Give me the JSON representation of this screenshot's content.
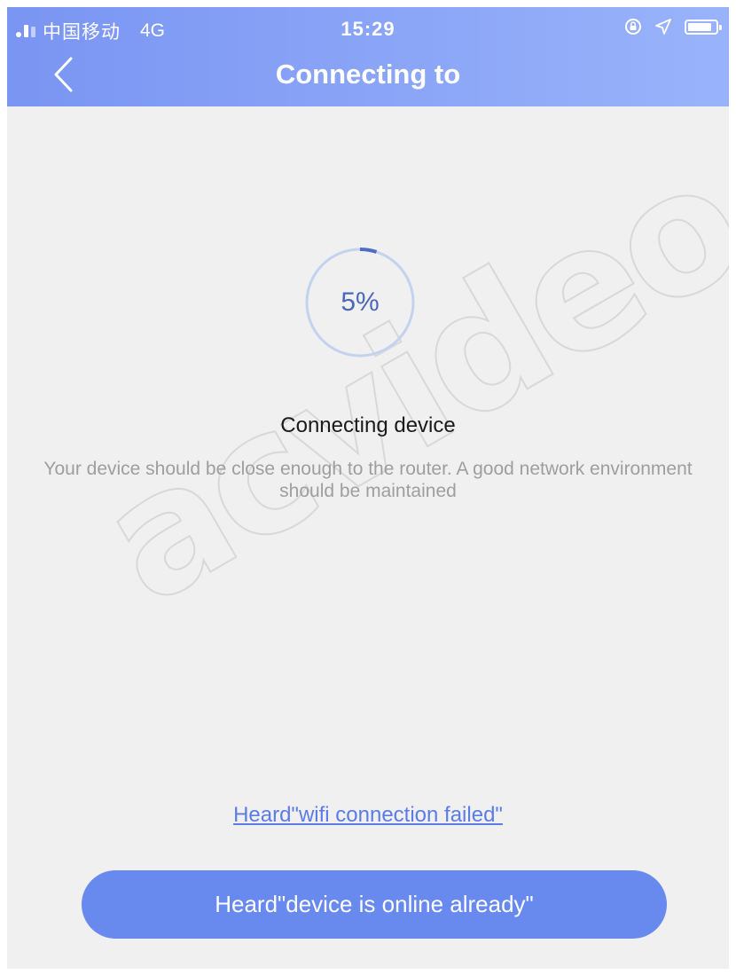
{
  "status_bar": {
    "carrier": "中国移动",
    "network": "4G",
    "time": "15:29",
    "battery_level": 0.85
  },
  "header": {
    "title": "Connecting to",
    "back_icon": "chevron-left-icon"
  },
  "progress": {
    "value": 0.05,
    "label": "5%"
  },
  "main": {
    "status_title": "Connecting device",
    "hint": "Your device should be close enough to the router. A good network environment should be maintained"
  },
  "actions": {
    "fail_link": "Heard\"wifi connection failed\"",
    "online_button": "Heard\"device is online already\""
  },
  "watermark": "acvideo.ru",
  "colors": {
    "header_start": "#7a95f2",
    "header_end": "#99b3fb",
    "accent": "#6889ee",
    "background": "#f0f0f0"
  }
}
